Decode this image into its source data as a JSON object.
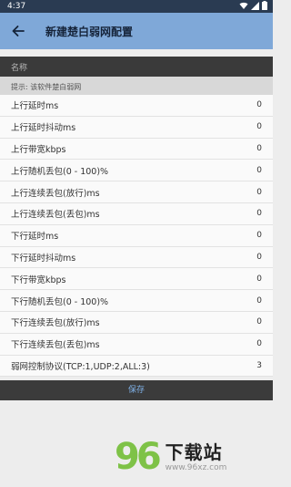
{
  "status_bar": {
    "time": "4:37"
  },
  "app_bar": {
    "title": "新建楚白弱网配置"
  },
  "form": {
    "name_label": "名称",
    "hint": "提示: 该软件楚白弱网",
    "settings": [
      {
        "label": "上行延时ms",
        "value": "0"
      },
      {
        "label": "上行延时抖动ms",
        "value": "0"
      },
      {
        "label": "上行带宽kbps",
        "value": "0"
      },
      {
        "label": "上行随机丢包(0 - 100)%",
        "value": "0"
      },
      {
        "label": "上行连续丢包(放行)ms",
        "value": "0"
      },
      {
        "label": "上行连续丢包(丢包)ms",
        "value": "0"
      },
      {
        "label": "下行延时ms",
        "value": "0"
      },
      {
        "label": "下行延时抖动ms",
        "value": "0"
      },
      {
        "label": "下行带宽kbps",
        "value": "0"
      },
      {
        "label": "下行随机丢包(0 - 100)%",
        "value": "0"
      },
      {
        "label": "下行连续丢包(放行)ms",
        "value": "0"
      },
      {
        "label": "下行连续丢包(丢包)ms",
        "value": "0"
      },
      {
        "label": "弱网控制协议(TCP:1,UDP:2,ALL:3)",
        "value": "3"
      }
    ]
  },
  "save_button": {
    "label": "保存"
  },
  "watermark": {
    "logo": "96",
    "brand": "下载站",
    "url": "www.96xz.com"
  },
  "colors": {
    "app_bar": "#7fa8d8",
    "status_bar": "#2a3b52",
    "save_text": "#7fb0e6",
    "watermark_green": "#7ec247"
  }
}
